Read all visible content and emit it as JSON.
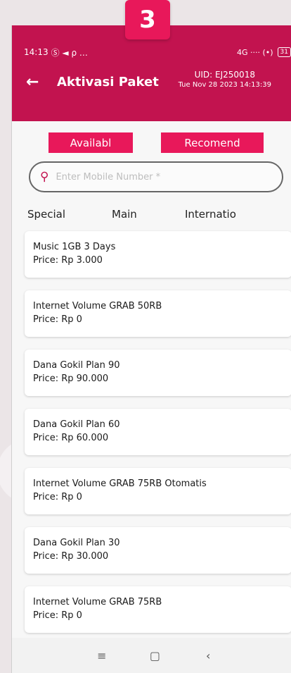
{
  "step_badge": "3",
  "status_bar": {
    "time": "14:13",
    "left_icons": "Ⓢ ◄ ρ …",
    "right_icons": "4G ···· (•)",
    "battery": "31"
  },
  "header": {
    "title": "Aktivasi Paket",
    "uid": "UID: EJ250018",
    "datetime": "Tue Nov 28 2023 14:13:39"
  },
  "tab_buttons": [
    "Availabl",
    "Recomend"
  ],
  "search": {
    "placeholder": "Enter Mobile Number *",
    "value": ""
  },
  "category_tabs": [
    "Special",
    "Main",
    "Internatio"
  ],
  "packages": [
    {
      "name": "Music 1GB 3 Days",
      "price": "Price: Rp 3.000"
    },
    {
      "name": "Internet Volume GRAB 50RB",
      "price": "Price: Rp 0"
    },
    {
      "name": "Dana Gokil Plan 90",
      "price": "Price: Rp 90.000"
    },
    {
      "name": "Dana Gokil Plan 60",
      "price": "Price: Rp 60.000"
    },
    {
      "name": "Internet Volume GRAB 75RB Otomatis",
      "price": "Price: Rp 0"
    },
    {
      "name": "Dana Gokil Plan 30",
      "price": "Price: Rp 30.000"
    },
    {
      "name": "Internet Volume GRAB 75RB",
      "price": "Price: Rp 0"
    }
  ],
  "nav_bar": {
    "recents": "≡",
    "home": "▢",
    "back": "‹"
  },
  "colors": {
    "primary": "#c2134f",
    "accent": "#e8185a"
  }
}
